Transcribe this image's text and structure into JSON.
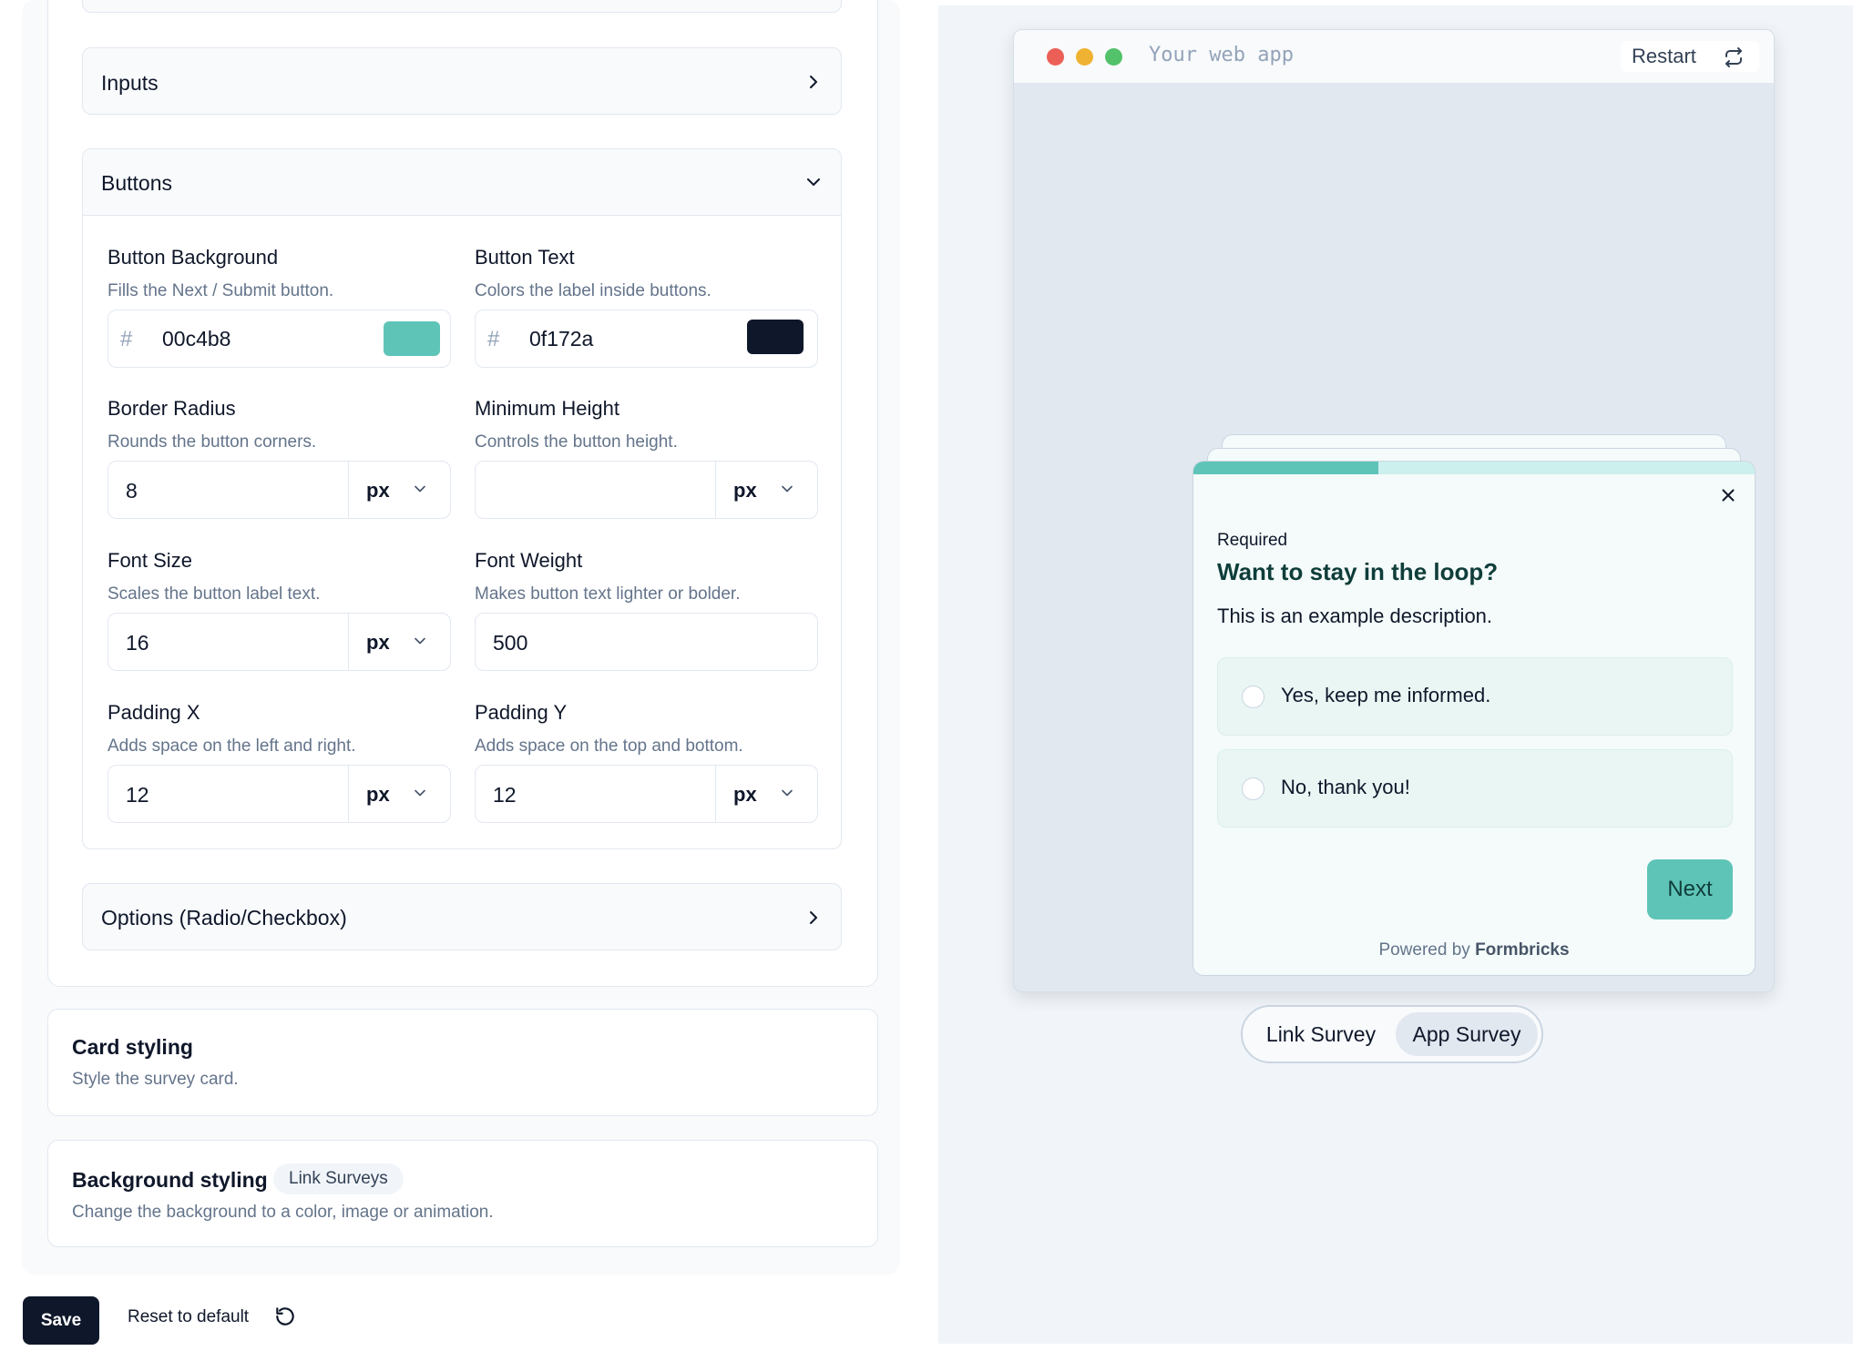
{
  "editor": {
    "accordions": {
      "inputs": {
        "title": "Inputs"
      },
      "buttons": {
        "title": "Buttons"
      },
      "options": {
        "title": "Options (Radio/Checkbox)"
      }
    },
    "fields": {
      "button_background": {
        "label": "Button Background",
        "desc": "Fills the Next / Submit button.",
        "hash": "#",
        "value": "00c4b8",
        "swatch": "#5fc4b8"
      },
      "button_text": {
        "label": "Button Text",
        "desc": "Colors the label inside buttons.",
        "hash": "#",
        "value": "0f172a",
        "swatch": "#0f172a"
      },
      "border_radius": {
        "label": "Border Radius",
        "desc": "Rounds the button corners.",
        "value": "8",
        "unit": "px"
      },
      "minimum_height": {
        "label": "Minimum Height",
        "desc": "Controls the button height.",
        "value": "",
        "unit": "px"
      },
      "font_size": {
        "label": "Font Size",
        "desc": "Scales the button label text.",
        "value": "16",
        "unit": "px"
      },
      "font_weight": {
        "label": "Font Weight",
        "desc": "Makes button text lighter or bolder.",
        "value": "500"
      },
      "padding_x": {
        "label": "Padding X",
        "desc": "Adds space on the left and right.",
        "value": "12",
        "unit": "px"
      },
      "padding_y": {
        "label": "Padding Y",
        "desc": "Adds space on the top and bottom.",
        "value": "12",
        "unit": "px"
      }
    },
    "card_styling": {
      "title": "Card styling",
      "desc": "Style the survey card."
    },
    "background_styling": {
      "title": "Background styling",
      "badge": "Link Surveys",
      "desc": "Change the background to a color, image or animation."
    },
    "save_label": "Save",
    "reset_label": "Reset to default"
  },
  "preview": {
    "url": "Your web app",
    "restart_label": "Restart",
    "dot_colors": [
      "#ec5f57",
      "#f0b232",
      "#53c26a"
    ],
    "survey": {
      "progress": 0.33,
      "required": "Required",
      "question": "Want to stay in the loop?",
      "description": "This is an example description.",
      "options": [
        "Yes, keep me informed.",
        "No, thank you!"
      ],
      "next_label": "Next",
      "powered_prefix": "Powered by",
      "powered_brand": "Formbricks"
    },
    "toggle": {
      "link": "Link Survey",
      "app": "App Survey",
      "active": "app"
    }
  }
}
